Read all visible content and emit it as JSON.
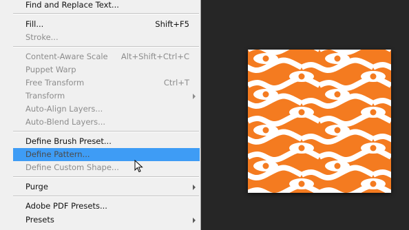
{
  "menu": {
    "items": [
      {
        "label": "Find and Replace Text...",
        "shortcut": "",
        "state": "enabled",
        "submenu": false
      },
      {
        "label": "Fill...",
        "shortcut": "Shift+F5",
        "state": "enabled",
        "submenu": false
      },
      {
        "label": "Stroke...",
        "shortcut": "",
        "state": "disabled",
        "submenu": false
      },
      {
        "label": "Content-Aware Scale",
        "shortcut": "Alt+Shift+Ctrl+C",
        "state": "disabled",
        "submenu": false
      },
      {
        "label": "Puppet Warp",
        "shortcut": "",
        "state": "disabled",
        "submenu": false
      },
      {
        "label": "Free Transform",
        "shortcut": "Ctrl+T",
        "state": "disabled",
        "submenu": false
      },
      {
        "label": "Transform",
        "shortcut": "",
        "state": "disabled",
        "submenu": true
      },
      {
        "label": "Auto-Align Layers...",
        "shortcut": "",
        "state": "disabled",
        "submenu": false
      },
      {
        "label": "Auto-Blend Layers...",
        "shortcut": "",
        "state": "disabled",
        "submenu": false
      },
      {
        "label": "Define Brush Preset...",
        "shortcut": "",
        "state": "enabled",
        "submenu": false
      },
      {
        "label": "Define Pattern...",
        "shortcut": "",
        "state": "highlighted",
        "submenu": false
      },
      {
        "label": "Define Custom Shape...",
        "shortcut": "",
        "state": "disabled",
        "submenu": false
      },
      {
        "label": "Purge",
        "shortcut": "",
        "state": "enabled",
        "submenu": true
      },
      {
        "label": "Adobe PDF Presets...",
        "shortcut": "",
        "state": "enabled",
        "submenu": false
      },
      {
        "label": "Presets",
        "shortcut": "",
        "state": "enabled",
        "submenu": true
      }
    ]
  },
  "pattern": {
    "name": "orange-eye-wave-pattern",
    "colors": {
      "background": "#f47b20",
      "wave": "#ffffff",
      "eye": "#ffffff",
      "pupil": "#f47b20"
    }
  },
  "theme": {
    "workspace": "#262626",
    "menu_bg": "#f0f0f0",
    "highlight": "#3e9cf5"
  }
}
